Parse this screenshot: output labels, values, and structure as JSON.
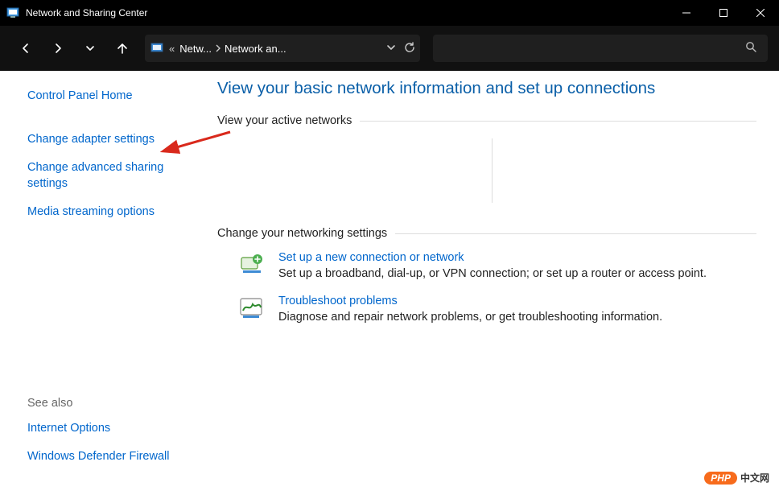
{
  "window": {
    "title": "Network and Sharing Center"
  },
  "breadcrumb": {
    "seg1": "Netw...",
    "seg2": "Network an..."
  },
  "sidebar": {
    "home": "Control Panel Home",
    "adapter": "Change adapter settings",
    "advanced": "Change advanced sharing settings",
    "media": "Media streaming options",
    "seealso_label": "See also",
    "internet_options": "Internet Options",
    "firewall": "Windows Defender Firewall"
  },
  "main": {
    "heading": "View your basic network information and set up connections",
    "active_section": "View your active networks",
    "change_section": "Change your networking settings",
    "setup": {
      "title": "Set up a new connection or network",
      "desc": "Set up a broadband, dial-up, or VPN connection; or set up a router or access point."
    },
    "troubleshoot": {
      "title": "Troubleshoot problems",
      "desc": "Diagnose and repair network problems, or get troubleshooting information."
    }
  },
  "watermark": {
    "php": "PHP",
    "cn": "中文网"
  }
}
